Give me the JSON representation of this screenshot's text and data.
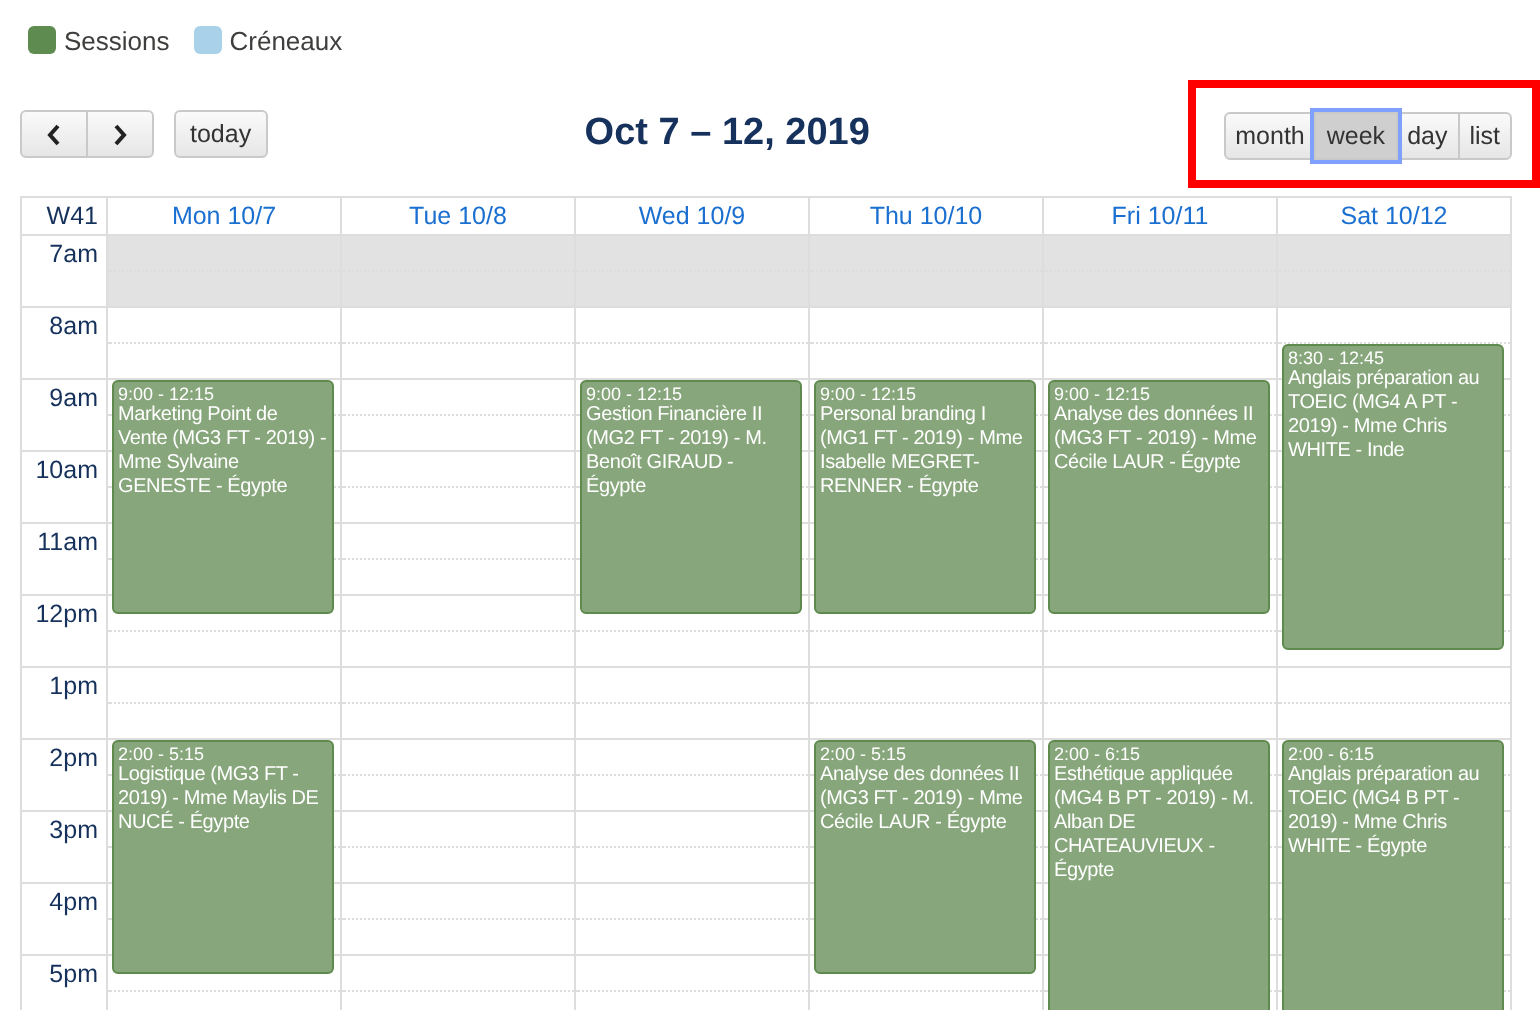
{
  "legend": [
    {
      "label": "Sessions",
      "color": "#5e8b50"
    },
    {
      "label": "Créneaux",
      "color": "#a9d1ea"
    }
  ],
  "toolbar": {
    "today": "today",
    "title": "Oct 7 – 12, 2019",
    "views": [
      {
        "label": "month",
        "selected": false
      },
      {
        "label": "week",
        "selected": true
      },
      {
        "label": "day",
        "selected": false
      },
      {
        "label": "list",
        "selected": false
      }
    ],
    "highlighted": true
  },
  "week_label": "W41",
  "hours": [
    {
      "label": "7am",
      "shaded": true
    },
    {
      "label": "8am",
      "shaded": false
    },
    {
      "label": "9am",
      "shaded": false
    },
    {
      "label": "10am",
      "shaded": false
    },
    {
      "label": "11am",
      "shaded": false
    },
    {
      "label": "12pm",
      "shaded": false
    },
    {
      "label": "1pm",
      "shaded": false
    },
    {
      "label": "2pm",
      "shaded": false
    },
    {
      "label": "3pm",
      "shaded": false
    },
    {
      "label": "4pm",
      "shaded": false
    },
    {
      "label": "5pm",
      "shaded": false
    }
  ],
  "days": [
    {
      "label": "Mon 10/7",
      "events": [
        {
          "time": "9:00 - 12:15",
          "title": "Marketing Point de Vente (MG3 FT - 2019) - Mme Sylvaine GENESTE - Égypte"
        },
        {
          "time": "2:00 - 5:15",
          "title": "Logistique (MG3 FT - 2019) - Mme Maylis DE NUCÉ - Égypte"
        }
      ]
    },
    {
      "label": "Tue 10/8"
    },
    {
      "label": "Wed 10/9",
      "events": [
        {
          "time": "9:00 - 12:15",
          "title": "Gestion Financière II (MG2 FT - 2019) - M. Benoît GIRAUD - Égypte"
        }
      ]
    },
    {
      "label": "Thu 10/10",
      "events": [
        {
          "time": "9:00 - 12:15",
          "title": "Personal branding I (MG1 FT - 2019) - Mme Isabelle MEGRET-RENNER - Égypte"
        },
        {
          "time": "2:00 - 5:15",
          "title": "Analyse des données II (MG3 FT - 2019) - Mme Cécile LAUR - Égypte"
        }
      ]
    },
    {
      "label": "Fri 10/11",
      "events": [
        {
          "time": "9:00 - 12:15",
          "title": "Analyse des données II (MG3 FT - 2019) - Mme Cécile LAUR - Égypte"
        },
        {
          "time": "2:00 - 6:15",
          "title": "Esthétique appliquée (MG4 B PT - 2019) - M. Alban DE CHATEAUVIEUX - Égypte"
        }
      ]
    },
    {
      "label": "Sat 10/12",
      "events": [
        {
          "time": "8:30 - 12:45",
          "title": "Anglais préparation au TOEIC (MG4 A PT - 2019) - Mme Chris WHITE - Inde"
        },
        {
          "time": "2:00 - 6:15",
          "title": "Anglais préparation au TOEIC (MG4 B PT - 2019) - Mme Chris WHITE - Égypte"
        }
      ]
    }
  ]
}
